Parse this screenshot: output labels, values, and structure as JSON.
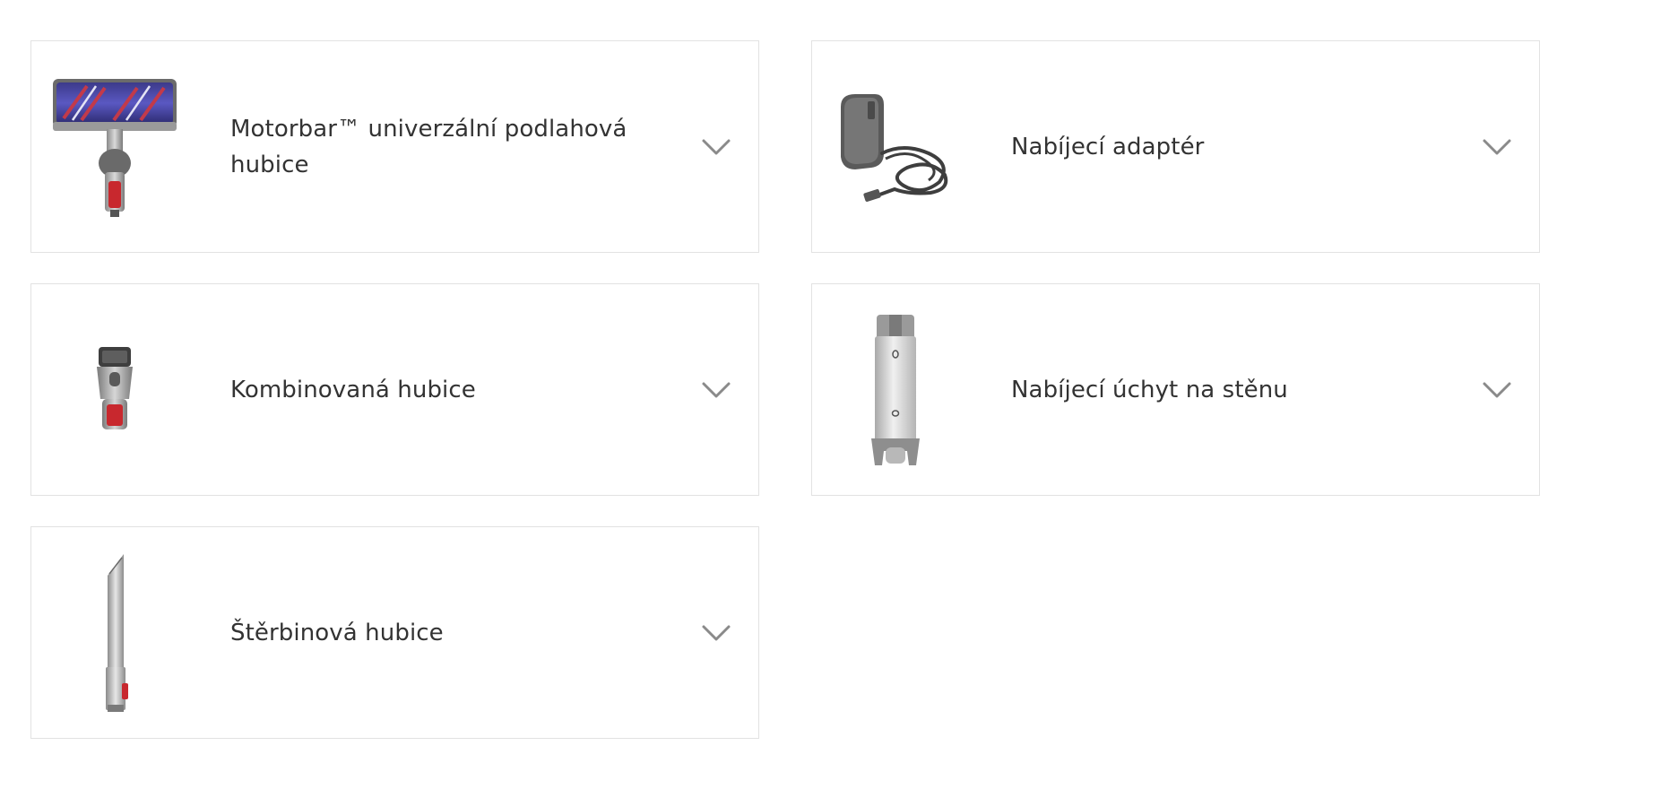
{
  "accessories": [
    {
      "name": "Motorbar™ univerzální podlahová hubice",
      "icon": "motorbar-floor-head-icon"
    },
    {
      "name": "Nabíjecí adaptér",
      "icon": "charging-adapter-icon"
    },
    {
      "name": "Kombinovaná hubice",
      "icon": "combination-tool-icon"
    },
    {
      "name": "Nabíjecí úchyt na stěnu",
      "icon": "wall-dock-icon"
    },
    {
      "name": "Štěrbinová hubice",
      "icon": "crevice-tool-icon"
    }
  ],
  "chevron_icon": "chevron-down-icon",
  "colors": {
    "border": "#e2e2e2",
    "text": "#333333",
    "chevron": "#8a8a8a",
    "accent_red": "#c8282e"
  }
}
